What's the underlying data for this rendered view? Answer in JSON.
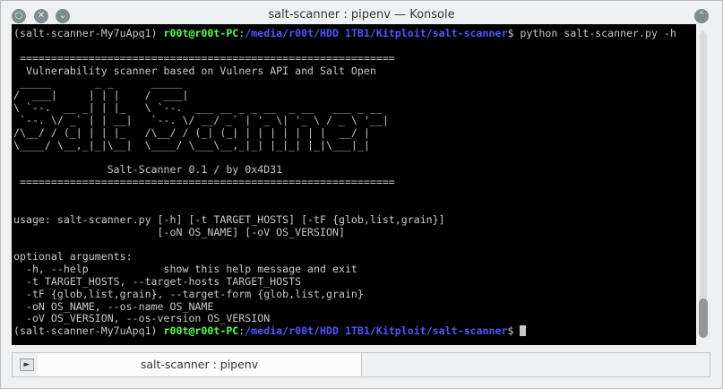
{
  "window": {
    "title": "salt-scanner : pipenv — Konsole",
    "left_buttons": [
      {
        "name": "app-menu-icon",
        "glyph": "○"
      },
      {
        "name": "close-icon",
        "glyph": "✕"
      },
      {
        "name": "chevron-down-icon",
        "glyph": "⌄"
      }
    ],
    "right_button": {
      "name": "chevron-up-icon",
      "glyph": "⌃"
    }
  },
  "terminal": {
    "prompt": {
      "env": "(salt-scanner-My7uApq1) ",
      "user": "r00t@r00t-PC",
      "sep": ":",
      "path": "/media/r00t/HDD 1TB1/Kitploit/salt-scanner",
      "dollar": "$ "
    },
    "command": "python salt-scanner.py -h",
    "output": [
      "",
      " ============================================================",
      "  Vulnerability scanner based on Vulners API and Salt Open",
      " _____       _ _      _____",
      "/  ___|     | | |    /  ___|",
      "\\ `--.  __ _| | |_   \\ `--.  ___ __ _ _ __  _ __   ___ _ __",
      " `--. \\/ _` | | __|   `--. \\/ __/ _` | '_ \\| '_ \\ / _ \\ '__|",
      "/\\__/ / (_| | | |_   /\\__/ / (_| (_| | | | | | | |  __/ |",
      "\\____/ \\__,_|_|\\__|  \\____/ \\___\\__,_|_| |_|_| |_|\\___|_|",
      "",
      "               Salt-Scanner 0.1 / by 0x4D31",
      " ============================================================",
      "",
      "",
      "usage: salt-scanner.py [-h] [-t TARGET_HOSTS] [-tF {glob,list,grain}]",
      "                       [-oN OS_NAME] [-oV OS_VERSION]",
      "",
      "optional arguments:",
      "  -h, --help            show this help message and exit",
      "  -t TARGET_HOSTS, --target-hosts TARGET_HOSTS",
      "  -tF {glob,list,grain}, --target-form {glob,list,grain}",
      "  -oN OS_NAME, --os-name OS_NAME",
      "  -oV OS_VERSION, --os-version OS_VERSION"
    ]
  },
  "tabs": [
    {
      "label": "salt-scanner : pipenv",
      "active": true
    }
  ],
  "new_tab_icon": "new-tab-icon",
  "colors": {
    "terminal_bg": "#000000",
    "terminal_fg": "#c8c8c8",
    "prompt_user": "#54ff54",
    "prompt_path": "#5454ff",
    "chrome": "#eff0f1"
  }
}
